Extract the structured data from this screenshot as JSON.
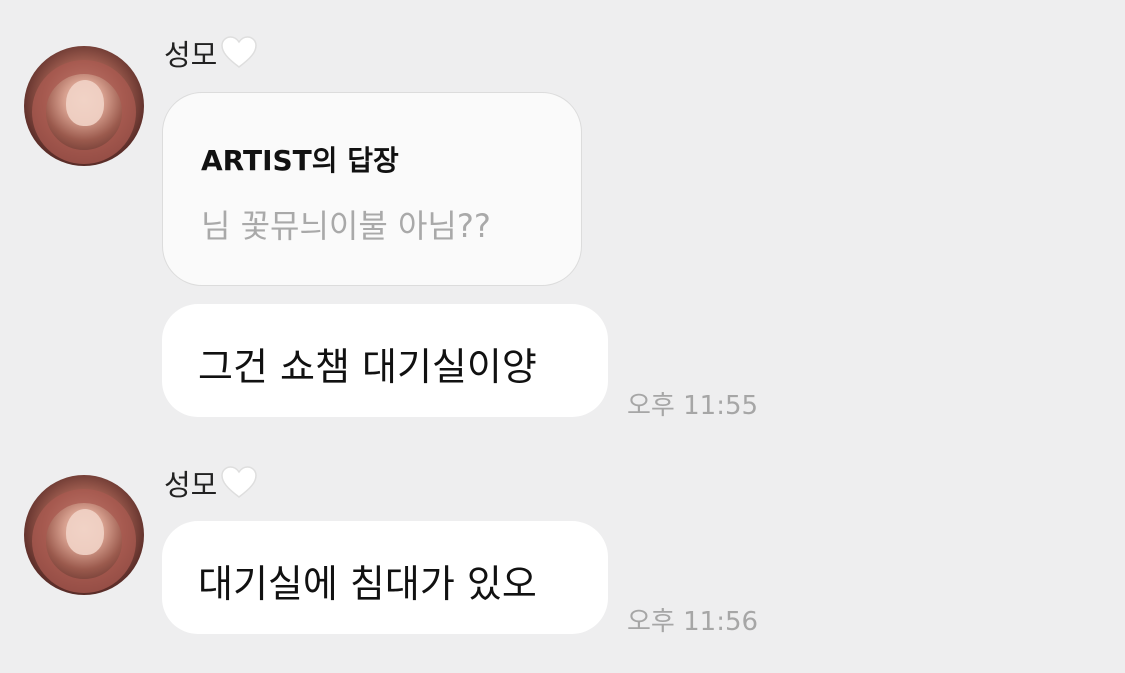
{
  "messages": [
    {
      "sender": "성모",
      "reply": {
        "title": "ARTIST의 답장",
        "quote": "님 꽃뮤늬이불 아님??"
      },
      "text": "그건 쇼챔 대기실이양",
      "time": "오후 11:55"
    },
    {
      "sender": "성모",
      "text": "대기실에 침대가 있오",
      "time": "오후 11:56"
    }
  ],
  "icons": {
    "heart": "white-heart-icon"
  },
  "colors": {
    "background": "#eeeeef",
    "bubble": "#ffffff",
    "reply_bubble": "#fafafa",
    "timestamp": "#a6a6a6"
  }
}
